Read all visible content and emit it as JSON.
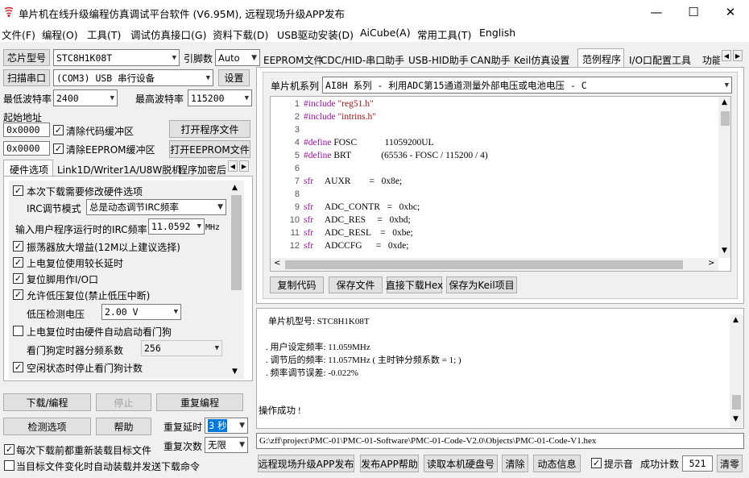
{
  "window": {
    "title": "单片机在线升级编程仿真调试平台软件 (V6.95M), 远程现场升级APP发布",
    "minimize": "—",
    "maximize": "☐",
    "close": "✕"
  },
  "menu": [
    "文件(F)",
    "编程(O)",
    "工具(T)",
    "调试仿真接口(G)",
    "资料下载(D)",
    "USB驱动安装(D)",
    "AiCube(A)",
    "常用工具(T)",
    "English"
  ],
  "left": {
    "chip_btn": "芯片型号",
    "chip_value": "STC8H1K08T",
    "pin_label": "引脚数",
    "pin_value": "Auto",
    "scan_btn": "扫描串口",
    "port_value": "(COM3) USB 串行设备",
    "settings_btn": "设置",
    "min_baud_label": "最低波特率",
    "min_baud_value": "2400",
    "max_baud_label": "最高波特率",
    "max_baud_value": "115200",
    "start_addr_label": "起始地址",
    "addr1": "0x0000",
    "clear_code_label": "清除代码缓冲区",
    "open_prog_btn": "打开程序文件",
    "addr2": "0x0000",
    "clear_eeprom_label": "清除EEPROM缓冲区",
    "open_eeprom_btn": "打开EEPROM文件",
    "tabs": [
      "硬件选项",
      "Link1D/Writer1A/U8W脱机",
      "程序加密后"
    ],
    "hw": {
      "modify_hw": "本次下载需要修改硬件选项",
      "irc_mode_label": "IRC调节模式",
      "irc_mode_value": "总是动态调节IRC频率",
      "irc_freq_label": "输入用户程序运行时的IRC频率",
      "irc_freq_value": "11.0592",
      "irc_unit": "MHz",
      "osc_gain": "振荡器放大增益(12M以上建议选择)",
      "por_delay": "上电复位使用较长延时",
      "reset_io": "复位脚用作I/O口",
      "lvd_reset": "允许低压复位(禁止低压中断)",
      "lvd_label": "低压检测电压",
      "lvd_value": "2.00 V",
      "wdt_auto": "上电复位时由硬件自动启动看门狗",
      "wdt_div_label": "看门狗定时器分频系数",
      "wdt_div_value": "256",
      "idle_wdt": "空闲状态时停止看门狗计数"
    },
    "download_btn": "下载/编程",
    "stop_btn": "停止",
    "reprogram_btn": "重复编程",
    "check_btn": "检测选项",
    "help_btn": "帮助",
    "repeat_delay_label": "重复延时",
    "repeat_delay_value": "3 秒",
    "repeat_count_label": "重复次数",
    "repeat_count_value": "无限",
    "reload_label": "每次下载前都重新装载目标文件",
    "auto_load_label": "当目标文件变化时自动装载并发送下载命令"
  },
  "right": {
    "tabs": [
      "EEPROM文件",
      "CDC/HID-串口助手",
      "USB-HID助手",
      "CAN助手",
      "Keil仿真设置",
      "范例程序",
      "I/O口配置工具",
      "功能"
    ],
    "active_tab": "范例程序",
    "series_label": "单片机系列",
    "example_value": "AI8H 系列 - 利用ADC第15通道测量外部电压或电池电压 - C",
    "code": [
      {
        "n": "1",
        "kw": "#include",
        "rest": " \"reg51.h\""
      },
      {
        "n": "2",
        "kw": "#include",
        "rest": " \"intrins.h\""
      },
      {
        "n": "3",
        "kw": "",
        "rest": ""
      },
      {
        "n": "4",
        "kw": "#define",
        "rest": " FOSC            11059200UL"
      },
      {
        "n": "5",
        "kw": "#define",
        "rest": " BRT             (65536 - FOSC / 115200 / 4)"
      },
      {
        "n": "6",
        "kw": "",
        "rest": ""
      },
      {
        "n": "7",
        "kw": "sfr",
        "rest": "     AUXR        =   0x8e;"
      },
      {
        "n": "8",
        "kw": "",
        "rest": ""
      },
      {
        "n": "9",
        "kw": "sfr",
        "rest": "     ADC_CONTR   =   0xbc;"
      },
      {
        "n": "10",
        "kw": "sfr",
        "rest": "     ADC_RES     =   0xbd;"
      },
      {
        "n": "11",
        "kw": "sfr",
        "rest": "     ADC_RESL    =   0xbe;"
      },
      {
        "n": "12",
        "kw": "sfr",
        "rest": "     ADCCFG      =   0xde;"
      }
    ],
    "copy_btn": "复制代码",
    "save_btn": "保存文件",
    "download_hex_btn": "直接下载Hex",
    "save_keil_btn": "保存为Keil项目",
    "log": [
      "单片机型号: STC8H1K08T",
      "",
      ". 用户设定频率: 11.059MHz",
      ". 调节后的频率: 11.057MHz ( 主时钟分频系数 = 1; )",
      ". 频率调节误差: -0.022%",
      "",
      "",
      "",
      "操作成功 !"
    ],
    "path": "G:\\zff\\project\\PMC-01\\PMC-01-Software\\PMC-01-Code-V2.0\\Objects\\PMC-01-Code-V1.hex",
    "remote_btn": "远程现场升级APP发布",
    "publish_help_btn": "发布APP帮助",
    "read_disk_btn": "读取本机硬盘号",
    "clear_btn": "清除",
    "anim_btn": "动态信息",
    "beep_label": "提示音",
    "success_label": "成功计数",
    "success_count": "521",
    "clear_zero_btn": "清零"
  }
}
